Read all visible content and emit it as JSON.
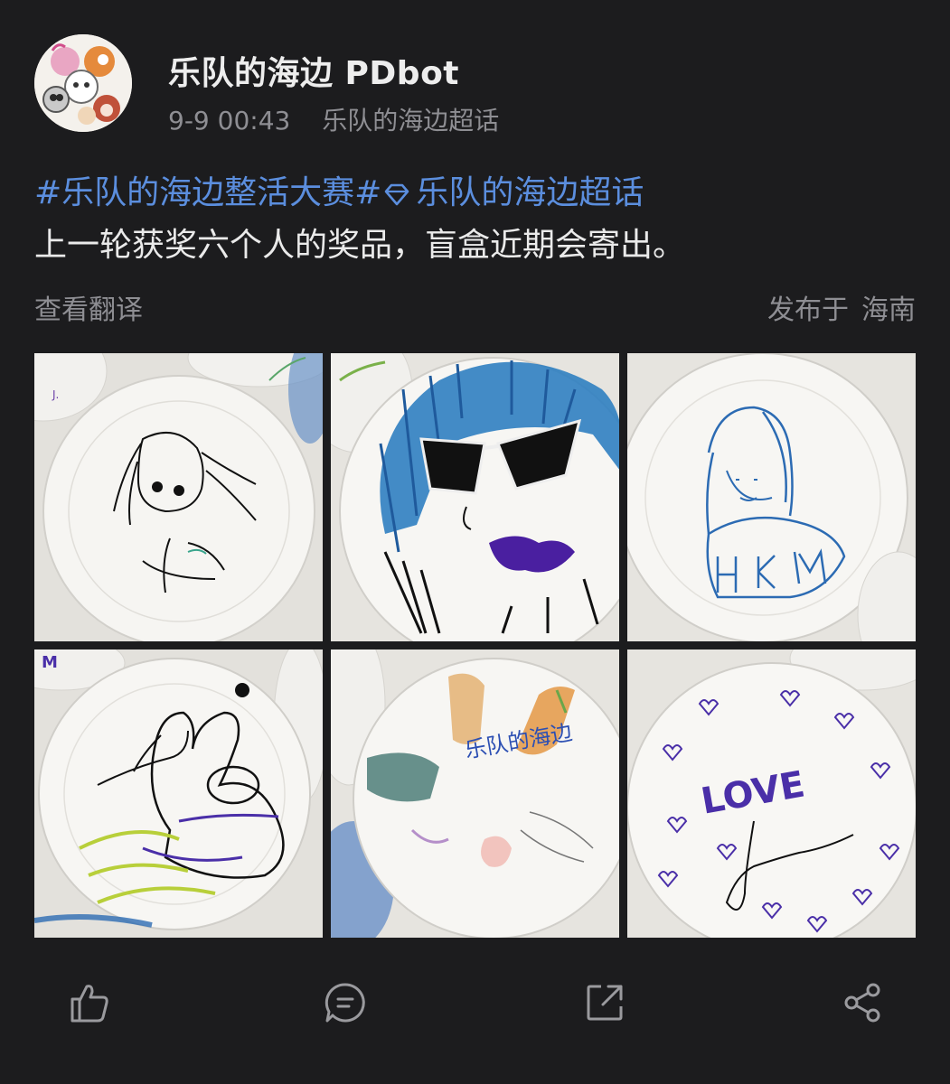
{
  "post": {
    "author": "乐队的海边 PDbot",
    "time": "9-9 00:43",
    "topic_source": "乐队的海边超话",
    "hashtag1": "#乐队的海边整活大赛#",
    "hashtag2": "乐队的海边超话",
    "text": "上一轮获奖六个人的奖品，盲盒近期会寄出。",
    "translate_label": "查看翻译",
    "location_prefix": "发布于",
    "location": "海南",
    "photo_count": 6
  },
  "photos": [
    {
      "caption": ""
    },
    {
      "caption": ""
    },
    {
      "caption": ""
    },
    {
      "caption": ""
    },
    {
      "caption": "乐队的海边"
    },
    {
      "caption": "LOVE"
    }
  ],
  "actions": [
    {
      "icon": "like-icon"
    },
    {
      "icon": "comment-icon"
    },
    {
      "icon": "repost-icon"
    },
    {
      "icon": "share-icon"
    }
  ],
  "colors": {
    "background": "#1c1c1e",
    "topic_link": "#5b8ede",
    "meta_gray": "#8e8e93",
    "icon_gray": "#9a9a9e"
  }
}
